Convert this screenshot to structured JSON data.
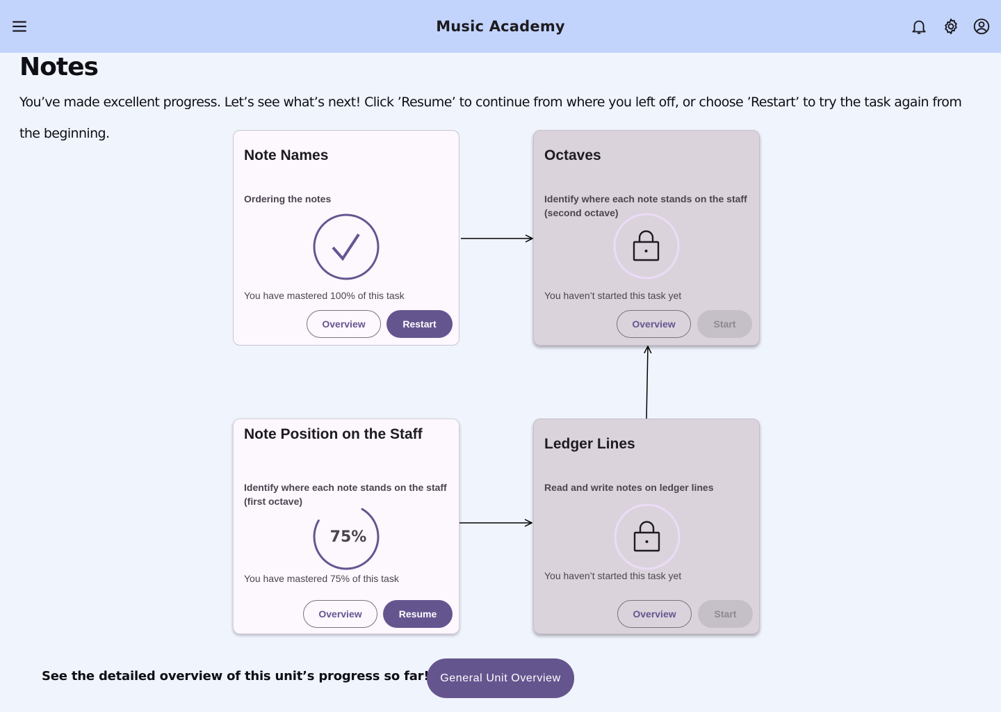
{
  "app": {
    "title": "Music Academy",
    "menu_icon": "menu-icon",
    "notifications_icon": "bell-icon",
    "settings_icon": "gear-icon",
    "account_icon": "account-circle-icon"
  },
  "page": {
    "title": "Notes",
    "intro": "You’ve made excellent progress. Let’s see what’s next! Click ’Resume’ to continue from where you left off, or choose ’Restart’ to try the task again from the beginning."
  },
  "cards": {
    "note_names": {
      "title": "Note Names",
      "subtitle": "Ordering the notes",
      "status": "You have mastered 100% of this task",
      "progress": 1.0,
      "overview_label": "Overview",
      "action_label": "Restart",
      "state": "completed"
    },
    "octaves": {
      "title": "Octaves",
      "subtitle": "Identify where each  note stands on the staff (second octave)",
      "status": "You haven’t started this task yet",
      "overview_label": "Overview",
      "action_label": "Start",
      "state": "locked"
    },
    "note_position": {
      "title": "Note Position on the Staff",
      "subtitle": "Identify where each note stands on the staff (first octave)",
      "status": "You have mastered 75% of this task",
      "progress": 0.75,
      "progress_label": "75%",
      "overview_label": "Overview",
      "action_label": "Resume",
      "state": "in-progress"
    },
    "ledger_lines": {
      "title": "Ledger Lines",
      "subtitle": "Read and write notes on ledger lines",
      "status": "You haven’t started this task yet",
      "overview_label": "Overview",
      "action_label": "Start",
      "state": "locked"
    }
  },
  "footer": {
    "text": "See the detailed overview of this unit’s progress so far!",
    "button_label": "General Unit Overview"
  },
  "colors": {
    "app_bar": "#c3d4fc",
    "background": "#f0f4fd",
    "primary": "#65558f",
    "locked_card": "#dbd3dc",
    "active_card": "#fdf7fe"
  }
}
